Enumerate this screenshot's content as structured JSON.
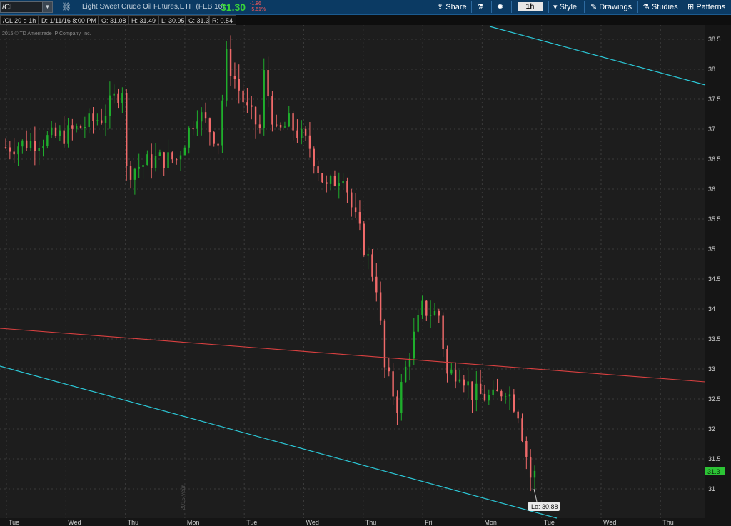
{
  "toolbar": {
    "symbol": "/CL",
    "description": "Light Sweet Crude Oil Futures,ETH (FEB 16)",
    "last_price": "31.30",
    "change": "-1.86",
    "change_pct": "-5.61%",
    "share_label": "Share",
    "timeframe": "1h",
    "style_label": "Style",
    "drawings_label": "Drawings",
    "studies_label": "Studies",
    "patterns_label": "Patterns"
  },
  "info": {
    "study": "/CL 20 d 1h",
    "date": "D: 1/11/16 8:00 PM",
    "open": "O: 31.08",
    "high": "H: 31.49",
    "low": "L: 30.95",
    "close": "C: 31.3",
    "range": "R: 0.54"
  },
  "watermark": "2015 © TD Ameritrade IP Company, Inc.",
  "year_label": "2015 year",
  "colors": {
    "up": "#1fae2c",
    "down": "#f06a6a",
    "channel": "#2bc7d6",
    "trend": "#d94040",
    "grid": "#3a3a3a",
    "bg": "#1d1d1d"
  },
  "chart_data": {
    "type": "candlestick",
    "x_ticks": [
      "Tue",
      "Wed",
      "Thu",
      "Mon",
      "Tue",
      "Wed",
      "Thu",
      "Fri",
      "Mon",
      "Tue",
      "Wed",
      "Thu"
    ],
    "y_ticks": [
      "38.5",
      "38",
      "37.5",
      "37",
      "36.5",
      "36",
      "35.5",
      "35",
      "34.5",
      "34",
      "33.5",
      "33",
      "32.5",
      "32",
      "31.5",
      "31"
    ],
    "ylim": [
      30.5,
      38.75
    ],
    "last_value_tag": "31.3",
    "low_callout": "Lo: 30.88",
    "waypoints": [
      [
        0,
        36.7
      ],
      [
        14,
        36.9
      ],
      [
        23,
        37.2
      ],
      [
        28,
        37.7
      ],
      [
        29,
        36.3
      ],
      [
        36,
        36.5
      ],
      [
        41,
        36.5
      ],
      [
        46,
        37.3
      ],
      [
        51,
        36.8
      ],
      [
        53,
        38.2
      ],
      [
        58,
        37.3
      ],
      [
        61,
        37.0
      ],
      [
        62,
        37.9
      ],
      [
        65,
        36.9
      ],
      [
        68,
        37.1
      ],
      [
        73,
        36.7
      ],
      [
        77,
        36.0
      ],
      [
        81,
        36.3
      ],
      [
        83,
        35.7
      ],
      [
        89,
        34.4
      ],
      [
        91,
        33.0
      ],
      [
        94,
        32.4
      ],
      [
        97,
        33.3
      ],
      [
        100,
        34.0
      ],
      [
        104,
        33.9
      ],
      [
        106,
        32.9
      ],
      [
        109,
        33.0
      ],
      [
        112,
        32.6
      ],
      [
        117,
        32.5
      ],
      [
        120,
        32.7
      ],
      [
        123,
        32.3
      ],
      [
        126,
        31.2
      ],
      [
        127,
        31.3
      ]
    ]
  }
}
